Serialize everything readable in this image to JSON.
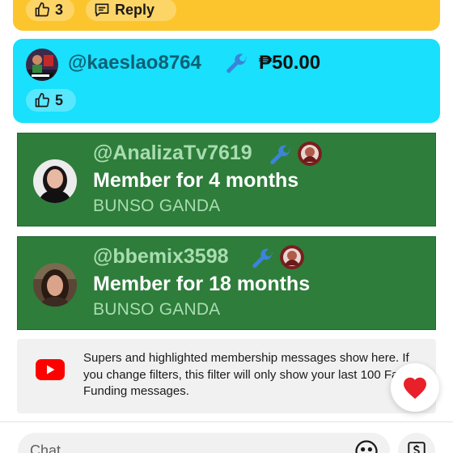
{
  "yellow_card": {
    "likes": "3",
    "reply_label": "Reply",
    "color": "#fcc52d"
  },
  "cyan_card": {
    "username": "@kaeslao8764",
    "amount": "₱50.00",
    "likes": "5",
    "color": "#18e0fd"
  },
  "members": [
    {
      "username": "@AnalizaTv7619",
      "headline": "Member for 4 months",
      "level": "BUNSO GANDA"
    },
    {
      "username": "@bbemix3598",
      "headline": "Member for 18 months",
      "level": "BUNSO GANDA"
    }
  ],
  "info": {
    "text": "Supers and highlighted membership messages show here. If you change filters, this filter will only show your last 100 Fan Funding messages.",
    "icon": "youtube-icon"
  },
  "chat": {
    "placeholder": "Chat"
  },
  "icons": {
    "like": "thumbs-up-icon",
    "reply": "reply-icon",
    "moderator": "wrench-icon",
    "reaction": "heart-icon",
    "emoji": "emoji-icon",
    "super_chat": "dollar-icon"
  },
  "colors": {
    "membership_green": "#2e7d3b",
    "wrench_blue": "#3b84d8",
    "youtube_red": "#ff0000"
  }
}
